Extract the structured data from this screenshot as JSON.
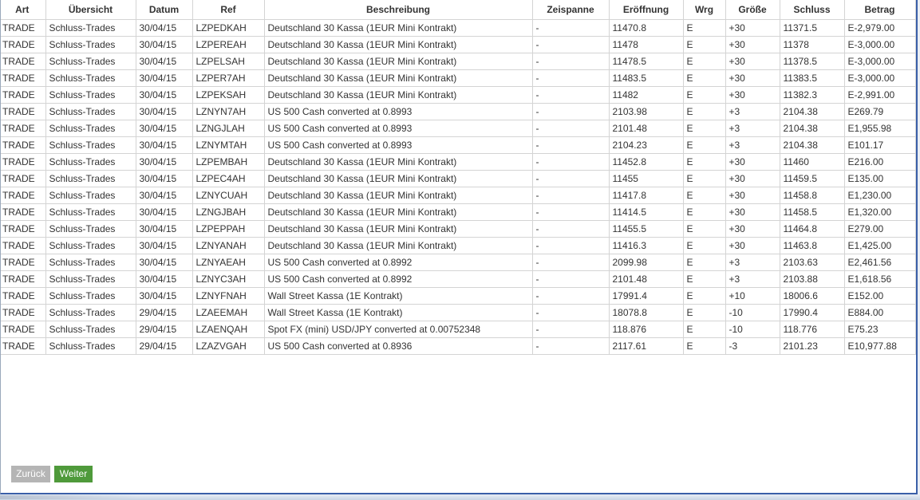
{
  "table": {
    "headers": [
      "Art",
      "Übersicht",
      "Datum",
      "Ref",
      "Beschreibung",
      "Zeispanne",
      "Eröffnung",
      "Wrg",
      "Größe",
      "Schluss",
      "Betrag"
    ],
    "rows": [
      [
        "TRADE",
        "Schluss-Trades",
        "30/04/15",
        "LZPEDKAH",
        "Deutschland 30 Kassa (1EUR Mini Kontrakt)",
        "-",
        "11470.8",
        "E",
        "+30",
        "11371.5",
        "E-2,979.00"
      ],
      [
        "TRADE",
        "Schluss-Trades",
        "30/04/15",
        "LZPEREAH",
        "Deutschland 30 Kassa (1EUR Mini Kontrakt)",
        "-",
        "11478",
        "E",
        "+30",
        "11378",
        "E-3,000.00"
      ],
      [
        "TRADE",
        "Schluss-Trades",
        "30/04/15",
        "LZPELSAH",
        "Deutschland 30 Kassa (1EUR Mini Kontrakt)",
        "-",
        "11478.5",
        "E",
        "+30",
        "11378.5",
        "E-3,000.00"
      ],
      [
        "TRADE",
        "Schluss-Trades",
        "30/04/15",
        "LZPER7AH",
        "Deutschland 30 Kassa (1EUR Mini Kontrakt)",
        "-",
        "11483.5",
        "E",
        "+30",
        "11383.5",
        "E-3,000.00"
      ],
      [
        "TRADE",
        "Schluss-Trades",
        "30/04/15",
        "LZPEKSAH",
        "Deutschland 30 Kassa (1EUR Mini Kontrakt)",
        "-",
        "11482",
        "E",
        "+30",
        "11382.3",
        "E-2,991.00"
      ],
      [
        "TRADE",
        "Schluss-Trades",
        "30/04/15",
        "LZNYN7AH",
        "US 500 Cash converted at 0.8993",
        "-",
        "2103.98",
        "E",
        "+3",
        "2104.38",
        "E269.79"
      ],
      [
        "TRADE",
        "Schluss-Trades",
        "30/04/15",
        "LZNGJLAH",
        "US 500 Cash converted at 0.8993",
        "-",
        "2101.48",
        "E",
        "+3",
        "2104.38",
        "E1,955.98"
      ],
      [
        "TRADE",
        "Schluss-Trades",
        "30/04/15",
        "LZNYMTAH",
        "US 500 Cash converted at 0.8993",
        "-",
        "2104.23",
        "E",
        "+3",
        "2104.38",
        "E101.17"
      ],
      [
        "TRADE",
        "Schluss-Trades",
        "30/04/15",
        "LZPEMBAH",
        "Deutschland 30 Kassa (1EUR Mini Kontrakt)",
        "-",
        "11452.8",
        "E",
        "+30",
        "11460",
        "E216.00"
      ],
      [
        "TRADE",
        "Schluss-Trades",
        "30/04/15",
        "LZPEC4AH",
        "Deutschland 30 Kassa (1EUR Mini Kontrakt)",
        "-",
        "11455",
        "E",
        "+30",
        "11459.5",
        "E135.00"
      ],
      [
        "TRADE",
        "Schluss-Trades",
        "30/04/15",
        "LZNYCUAH",
        "Deutschland 30 Kassa (1EUR Mini Kontrakt)",
        "-",
        "11417.8",
        "E",
        "+30",
        "11458.8",
        "E1,230.00"
      ],
      [
        "TRADE",
        "Schluss-Trades",
        "30/04/15",
        "LZNGJBAH",
        "Deutschland 30 Kassa (1EUR Mini Kontrakt)",
        "-",
        "11414.5",
        "E",
        "+30",
        "11458.5",
        "E1,320.00"
      ],
      [
        "TRADE",
        "Schluss-Trades",
        "30/04/15",
        "LZPEPPAH",
        "Deutschland 30 Kassa (1EUR Mini Kontrakt)",
        "-",
        "11455.5",
        "E",
        "+30",
        "11464.8",
        "E279.00"
      ],
      [
        "TRADE",
        "Schluss-Trades",
        "30/04/15",
        "LZNYANAH",
        "Deutschland 30 Kassa (1EUR Mini Kontrakt)",
        "-",
        "11416.3",
        "E",
        "+30",
        "11463.8",
        "E1,425.00"
      ],
      [
        "TRADE",
        "Schluss-Trades",
        "30/04/15",
        "LZNYAEAH",
        "US 500 Cash converted at 0.8992",
        "-",
        "2099.98",
        "E",
        "+3",
        "2103.63",
        "E2,461.56"
      ],
      [
        "TRADE",
        "Schluss-Trades",
        "30/04/15",
        "LZNYC3AH",
        "US 500 Cash converted at 0.8992",
        "-",
        "2101.48",
        "E",
        "+3",
        "2103.88",
        "E1,618.56"
      ],
      [
        "TRADE",
        "Schluss-Trades",
        "30/04/15",
        "LZNYFNAH",
        "Wall Street Kassa (1E Kontrakt)",
        "-",
        "17991.4",
        "E",
        "+10",
        "18006.6",
        "E152.00"
      ],
      [
        "TRADE",
        "Schluss-Trades",
        "29/04/15",
        "LZAEEMAH",
        "Wall Street Kassa (1E Kontrakt)",
        "-",
        "18078.8",
        "E",
        "-10",
        "17990.4",
        "E884.00"
      ],
      [
        "TRADE",
        "Schluss-Trades",
        "29/04/15",
        "LZAENQAH",
        "Spot FX (mini) USD/JPY converted at 0.00752348",
        "-",
        "118.876",
        "E",
        "-10",
        "118.776",
        "E75.23"
      ],
      [
        "TRADE",
        "Schluss-Trades",
        "29/04/15",
        "LZAZVGAH",
        "US 500 Cash converted at 0.8936",
        "-",
        "2117.61",
        "E",
        "-3",
        "2101.23",
        "E10,977.88"
      ]
    ]
  },
  "pagination": {
    "back_label": "Zurück",
    "next_label": "Weiter"
  },
  "colors": {
    "back_button": "#b5b5b5",
    "next_button": "#4f9a3b",
    "border": "#d4d4d4",
    "window_frame": "#3a5fa8"
  }
}
